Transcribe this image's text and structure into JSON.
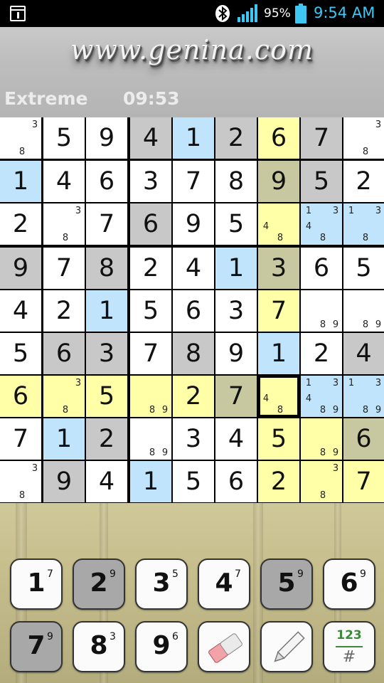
{
  "status_bar": {
    "battery": "95%",
    "time": "9:54 AM",
    "icons": [
      "notification-icon",
      "bluetooth-icon",
      "signal-icon",
      "battery-icon"
    ]
  },
  "header": {
    "logo": "www.genina.com",
    "difficulty": "Extreme",
    "timer": "09:53"
  },
  "colors": {
    "white": "#ffffff",
    "gray": "#c8c8c8",
    "blue": "#bfe4fb",
    "yellow": "#ffffa8",
    "olive": "#c8c8a0",
    "accent": "#3ec7f2"
  },
  "grid": {
    "values": [
      [
        "",
        "5",
        "9",
        "4",
        "1",
        "2",
        "6",
        "7",
        ""
      ],
      [
        "1",
        "4",
        "6",
        "3",
        "7",
        "8",
        "9",
        "5",
        "2"
      ],
      [
        "2",
        "",
        "7",
        "6",
        "9",
        "5",
        "",
        "",
        ""
      ],
      [
        "9",
        "7",
        "8",
        "2",
        "4",
        "1",
        "3",
        "6",
        "5"
      ],
      [
        "4",
        "2",
        "1",
        "5",
        "6",
        "3",
        "7",
        "",
        ""
      ],
      [
        "5",
        "6",
        "3",
        "7",
        "8",
        "9",
        "1",
        "2",
        "4"
      ],
      [
        "6",
        "",
        "5",
        "",
        "2",
        "7",
        "",
        "",
        ""
      ],
      [
        "7",
        "1",
        "2",
        "",
        "3",
        "4",
        "5",
        "",
        "6"
      ],
      [
        "",
        "9",
        "4",
        "1",
        "5",
        "6",
        "2",
        "",
        "7"
      ]
    ],
    "fills": [
      [
        "w",
        "w",
        "w",
        "g",
        "b",
        "g",
        "y",
        "g",
        "w"
      ],
      [
        "b",
        "w",
        "w",
        "w",
        "w",
        "w",
        "o",
        "g",
        "w"
      ],
      [
        "w",
        "w",
        "w",
        "g",
        "w",
        "w",
        "y",
        "b",
        "b"
      ],
      [
        "g",
        "w",
        "g",
        "w",
        "w",
        "b",
        "o",
        "w",
        "w"
      ],
      [
        "w",
        "w",
        "b",
        "w",
        "w",
        "w",
        "y",
        "w",
        "w"
      ],
      [
        "w",
        "g",
        "g",
        "w",
        "g",
        "w",
        "b",
        "w",
        "g"
      ],
      [
        "y",
        "y",
        "y",
        "y",
        "y",
        "o",
        "y",
        "b",
        "b"
      ],
      [
        "w",
        "b",
        "g",
        "w",
        "w",
        "w",
        "y",
        "y",
        "o"
      ],
      [
        "w",
        "g",
        "w",
        "b",
        "w",
        "w",
        "y",
        "y",
        "y"
      ]
    ],
    "notes": [
      [
        [
          "3",
          "8"
        ],
        [],
        [],
        [],
        [],
        [],
        [],
        [],
        [
          "3",
          "8"
        ]
      ],
      [
        [],
        [],
        [],
        [],
        [],
        [],
        [],
        [],
        []
      ],
      [
        [],
        [
          "3",
          "8"
        ],
        [],
        [],
        [],
        [],
        [
          "4",
          "8"
        ],
        [
          "1",
          "3",
          "4",
          "8"
        ],
        [
          "1",
          "3",
          "8"
        ]
      ],
      [
        [],
        [],
        [],
        [],
        [],
        [],
        [],
        [],
        []
      ],
      [
        [],
        [],
        [],
        [],
        [],
        [],
        [],
        [
          "8",
          "9"
        ],
        [
          "8",
          "9"
        ]
      ],
      [
        [],
        [],
        [],
        [],
        [],
        [],
        [],
        [],
        []
      ],
      [
        [],
        [
          "3",
          "8"
        ],
        [],
        [
          "8",
          "9"
        ],
        [],
        [],
        [
          "4",
          "8"
        ],
        [
          "1",
          "3",
          "4",
          "8",
          "9"
        ],
        [
          "1",
          "3",
          "8",
          "9"
        ]
      ],
      [
        [],
        [],
        [],
        [
          "8",
          "9"
        ],
        [],
        [],
        [],
        [
          "8",
          "9"
        ],
        []
      ],
      [
        [
          "3",
          "8"
        ],
        [],
        [],
        [],
        [],
        [],
        [],
        [
          "3",
          "8"
        ],
        []
      ]
    ],
    "selected": [
      6,
      6
    ]
  },
  "keypad": {
    "keys": [
      {
        "digit": "1",
        "count": "7",
        "dim": false
      },
      {
        "digit": "2",
        "count": "9",
        "dim": true
      },
      {
        "digit": "3",
        "count": "5",
        "dim": false
      },
      {
        "digit": "4",
        "count": "7",
        "dim": false
      },
      {
        "digit": "5",
        "count": "9",
        "dim": true
      },
      {
        "digit": "6",
        "count": "9",
        "dim": false
      },
      {
        "digit": "7",
        "count": "9",
        "dim": true
      },
      {
        "digit": "8",
        "count": "3",
        "dim": false
      },
      {
        "digit": "9",
        "count": "6",
        "dim": false
      }
    ],
    "eraser_icon": "eraser-icon",
    "pencil_icon": "pencil-icon",
    "mode_top": "123",
    "mode_bottom": "#"
  }
}
